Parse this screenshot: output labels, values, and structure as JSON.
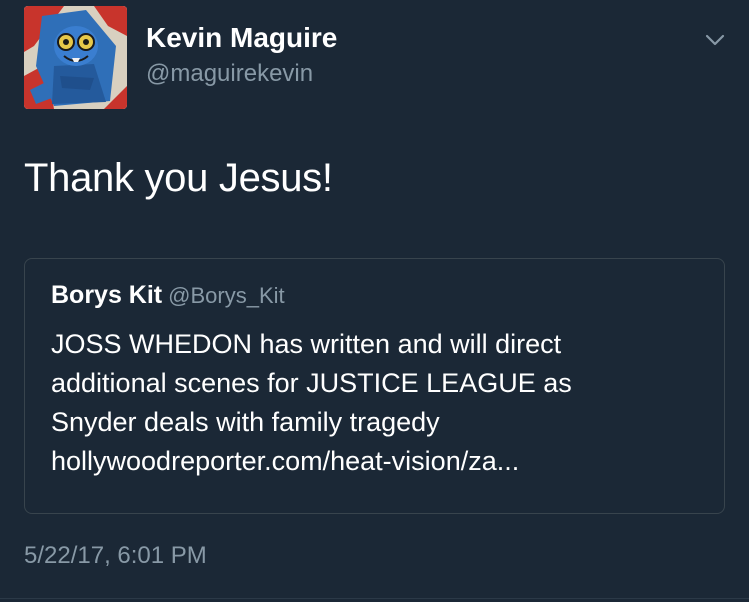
{
  "tweet": {
    "author": {
      "display_name": "Kevin Maguire",
      "handle": "@maguirekevin",
      "avatar_icon": "blue-beetle-comic-avatar-icon"
    },
    "menu_icon": "chevron-down-icon",
    "text": "Thank you Jesus!",
    "timestamp": "5/22/17, 6:01 PM"
  },
  "quoted_tweet": {
    "display_name": "Borys Kit",
    "handle": "@Borys_Kit",
    "lines": [
      "JOSS WHEDON has written and will direct",
      "additional scenes for JUSTICE LEAGUE as",
      "Snyder deals with family tragedy",
      "hollywoodreporter.com/heat-vision/za..."
    ]
  },
  "colors": {
    "background": "#1b2836",
    "primary_text": "#ffffff",
    "secondary_text": "#8899a6",
    "border": "#38444d"
  }
}
